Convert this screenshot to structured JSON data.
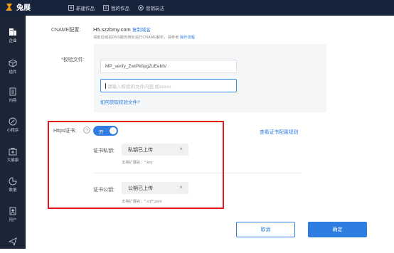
{
  "app": {
    "logo_text": "兔展"
  },
  "topnav": [
    {
      "label": "新建作品",
      "icon": "plus-square-icon"
    },
    {
      "label": "我的作品",
      "icon": "folder-icon"
    },
    {
      "label": "营销玩法",
      "icon": "settings-icon"
    }
  ],
  "sidebar": {
    "items": [
      {
        "label": "企业",
        "icon": "building-icon",
        "active": true
      },
      {
        "label": "插件",
        "icon": "cube-icon"
      },
      {
        "label": "内容",
        "icon": "document-icon"
      },
      {
        "label": "小程序",
        "icon": "link-icon"
      },
      {
        "label": "大健康",
        "icon": "medical-box-icon"
      },
      {
        "label": "数据",
        "icon": "pie-chart-icon"
      },
      {
        "label": "用户",
        "icon": "user-card-icon"
      },
      {
        "label": "",
        "icon": "send-icon"
      }
    ]
  },
  "form": {
    "cname_label": "CNAME配置:",
    "cname_value": "H5.szzbmy.com",
    "copy_domain_link": "复制域名",
    "cname_hint": "请前往域名DNS服务商处进行CNAME解析，请参考",
    "cname_hint_link": "操作流程",
    "verify_label": "*校验文件:",
    "verify_filename": "MP_verify_ZwtPkfipgZuEebtV",
    "verify_content_placeholder": "请输入校验的文件内容,如xxxxx",
    "verify_help_link": "如何获取校验文件?",
    "https_label": "Https证书:",
    "https_toggle_text": "开",
    "https_enabled": true,
    "view_cert_rules_link": "查看证书配置规则",
    "private_key_label": "证书私钥:",
    "private_key_value": "私钥已上传",
    "private_key_hint": "支持扩展名：*.key",
    "public_key_label": "证书公钥:",
    "public_key_value": "公钥已上传",
    "public_key_hint": "支持扩展名：*.crt/*.pem"
  },
  "actions": {
    "cancel": "取消",
    "confirm": "确定"
  },
  "colors": {
    "accent": "#2f7de1",
    "highlight_border": "#e5161a",
    "topbar": "#16233a",
    "sidebar": "#1b2536"
  }
}
